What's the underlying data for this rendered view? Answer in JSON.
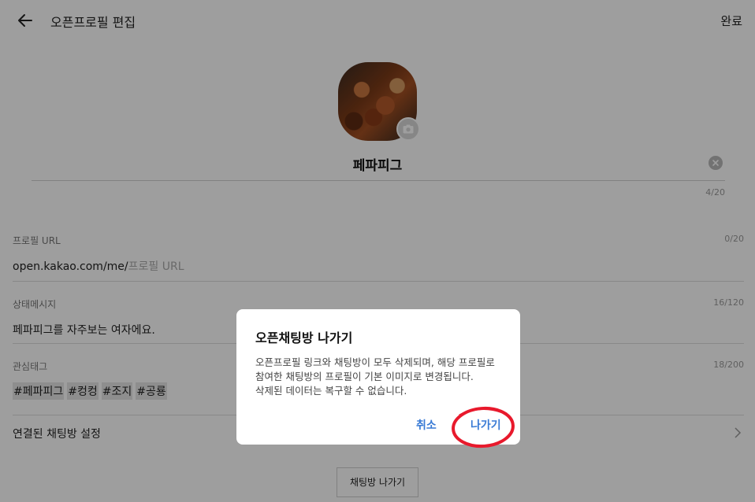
{
  "header": {
    "title": "오픈프로필 편집",
    "done_label": "완료"
  },
  "profile": {
    "name": "페파피그",
    "name_count": "4/20"
  },
  "url_field": {
    "label": "프로필 URL",
    "count": "0/20",
    "prefix": "open.kakao.com/me/",
    "placeholder": "프로필 URL"
  },
  "status_field": {
    "label": "상태메시지",
    "count": "16/120",
    "value": "페파피그를 자주보는 여자에요."
  },
  "tags_field": {
    "label": "관심태그",
    "count": "18/200",
    "tags": [
      "#페파피그",
      "#컹컹",
      "#조지",
      "#공룡"
    ]
  },
  "linked_row": {
    "label": "연결된 채팅방 설정"
  },
  "leave_button": {
    "label": "채팅방 나가기"
  },
  "dialog": {
    "title": "오픈채팅방 나가기",
    "body_lines": [
      "오픈프로필 링크와 채팅방이 모두 삭제되며, 해당 프로필로",
      "참여한 채팅방의 프로필이 기본 이미지로 변경됩니다.",
      "삭제된 데이터는 복구할 수 없습니다."
    ],
    "cancel_label": "취소",
    "leave_label": "나가기"
  },
  "colors": {
    "accent": "#3a7bd5",
    "annotation": "#e8192c",
    "dim_overlay": "rgba(0,0,0,0.38)"
  },
  "icons": {
    "back": "back-arrow-icon",
    "camera": "camera-icon",
    "clear": "clear-icon",
    "chevron": "chevron-right-icon"
  }
}
